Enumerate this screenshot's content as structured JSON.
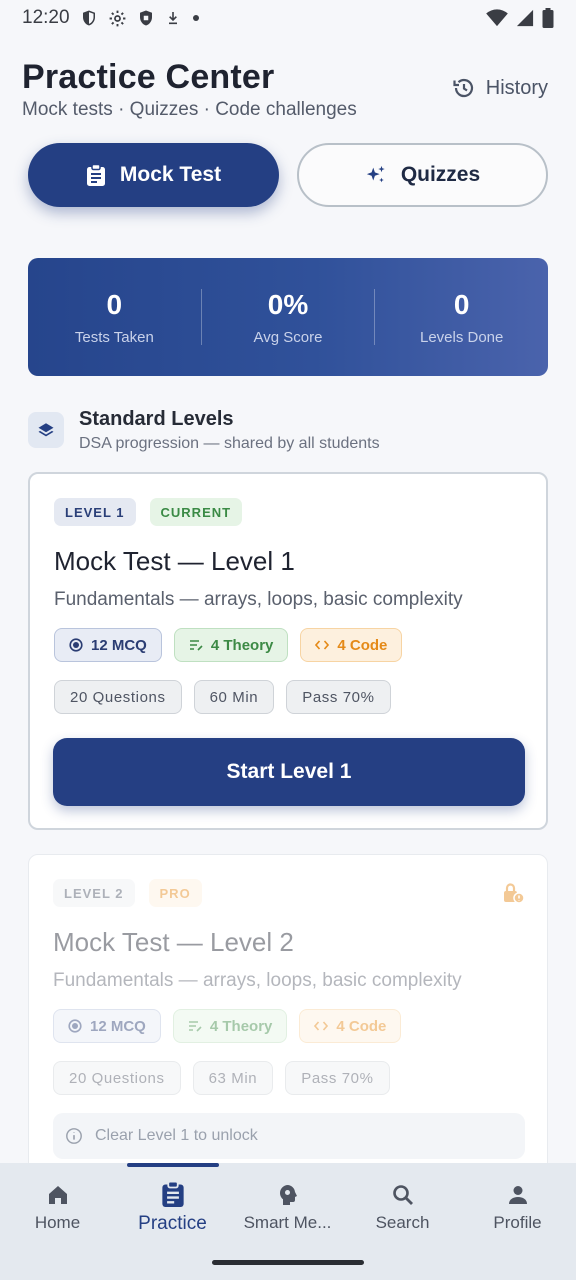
{
  "status_bar": {
    "time": "12:20"
  },
  "header": {
    "title": "Practice Center",
    "subtitle": "Mock tests · Quizzes · Code challenges",
    "history_label": "History"
  },
  "segments": {
    "mock_label": "Mock Test",
    "quiz_label": "Quizzes",
    "selected": "Mock Test"
  },
  "stats": [
    {
      "value": "0",
      "label": "Tests Taken"
    },
    {
      "value": "0%",
      "label": "Avg Score"
    },
    {
      "value": "0",
      "label": "Levels Done"
    }
  ],
  "section": {
    "title": "Standard Levels",
    "subtitle": "DSA progression — shared by all students"
  },
  "levels": [
    {
      "level_tag": "LEVEL 1",
      "status_tag": "CURRENT",
      "title": "Mock Test — Level 1",
      "description": "Fundamentals — arrays, loops, basic complexity",
      "mcq": "12 MCQ",
      "theory": "4 Theory",
      "code": "4 Code",
      "questions": "20 Questions",
      "minutes": "60 Min",
      "pass": "Pass 70%",
      "button_label": "Start Level 1"
    },
    {
      "level_tag": "LEVEL 2",
      "status_tag": "PRO",
      "title": "Mock Test — Level 2",
      "description": "Fundamentals — arrays, loops, basic complexity",
      "mcq": "12 MCQ",
      "theory": "4 Theory",
      "code": "4 Code",
      "questions": "20 Questions",
      "minutes": "63 Min",
      "pass": "Pass 70%",
      "unlock_note": "Clear Level 1 to unlock"
    }
  ],
  "nav": [
    {
      "label": "Home",
      "icon": "home-icon"
    },
    {
      "label": "Practice",
      "icon": "clipboard-icon",
      "active": true
    },
    {
      "label": "Smart Me...",
      "icon": "brain-icon"
    },
    {
      "label": "Search",
      "icon": "search-icon"
    },
    {
      "label": "Profile",
      "icon": "person-icon"
    }
  ],
  "colors": {
    "primary": "#243f83",
    "success": "#3a8a45",
    "warning": "#e58a18",
    "background": "#f6f7fa"
  }
}
